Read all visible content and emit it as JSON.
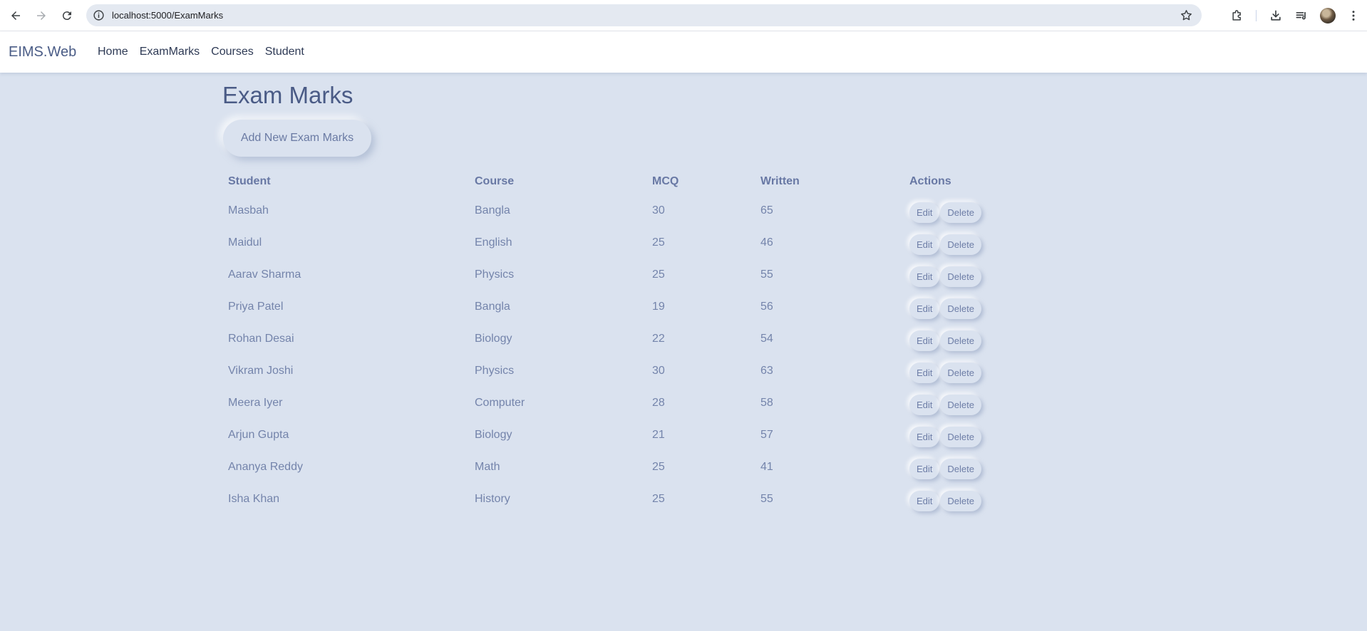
{
  "browser": {
    "url": "localhost:5000/ExamMarks"
  },
  "navbar": {
    "brand": "EIMS.Web",
    "links": [
      "Home",
      "ExamMarks",
      "Courses",
      "Student"
    ]
  },
  "page": {
    "title": "Exam Marks",
    "add_button": "Add New Exam Marks"
  },
  "table": {
    "headers": [
      "Student",
      "Course",
      "MCQ",
      "Written",
      "Actions"
    ],
    "rows": [
      {
        "student": "Masbah",
        "course": "Bangla",
        "mcq": "30",
        "written": "65"
      },
      {
        "student": "Maidul",
        "course": "English",
        "mcq": "25",
        "written": "46"
      },
      {
        "student": "Aarav Sharma",
        "course": "Physics",
        "mcq": "25",
        "written": "55"
      },
      {
        "student": "Priya Patel",
        "course": "Bangla",
        "mcq": "19",
        "written": "56"
      },
      {
        "student": "Rohan Desai",
        "course": "Biology",
        "mcq": "22",
        "written": "54"
      },
      {
        "student": "Vikram Joshi",
        "course": "Physics",
        "mcq": "30",
        "written": "63"
      },
      {
        "student": "Meera Iyer",
        "course": "Computer",
        "mcq": "28",
        "written": "58"
      },
      {
        "student": "Arjun Gupta",
        "course": "Biology",
        "mcq": "21",
        "written": "57"
      },
      {
        "student": "Ananya Reddy",
        "course": "Math",
        "mcq": "25",
        "written": "41"
      },
      {
        "student": "Isha Khan",
        "course": "History",
        "mcq": "25",
        "written": "55"
      }
    ],
    "edit_label": "Edit",
    "delete_label": "Delete"
  }
}
